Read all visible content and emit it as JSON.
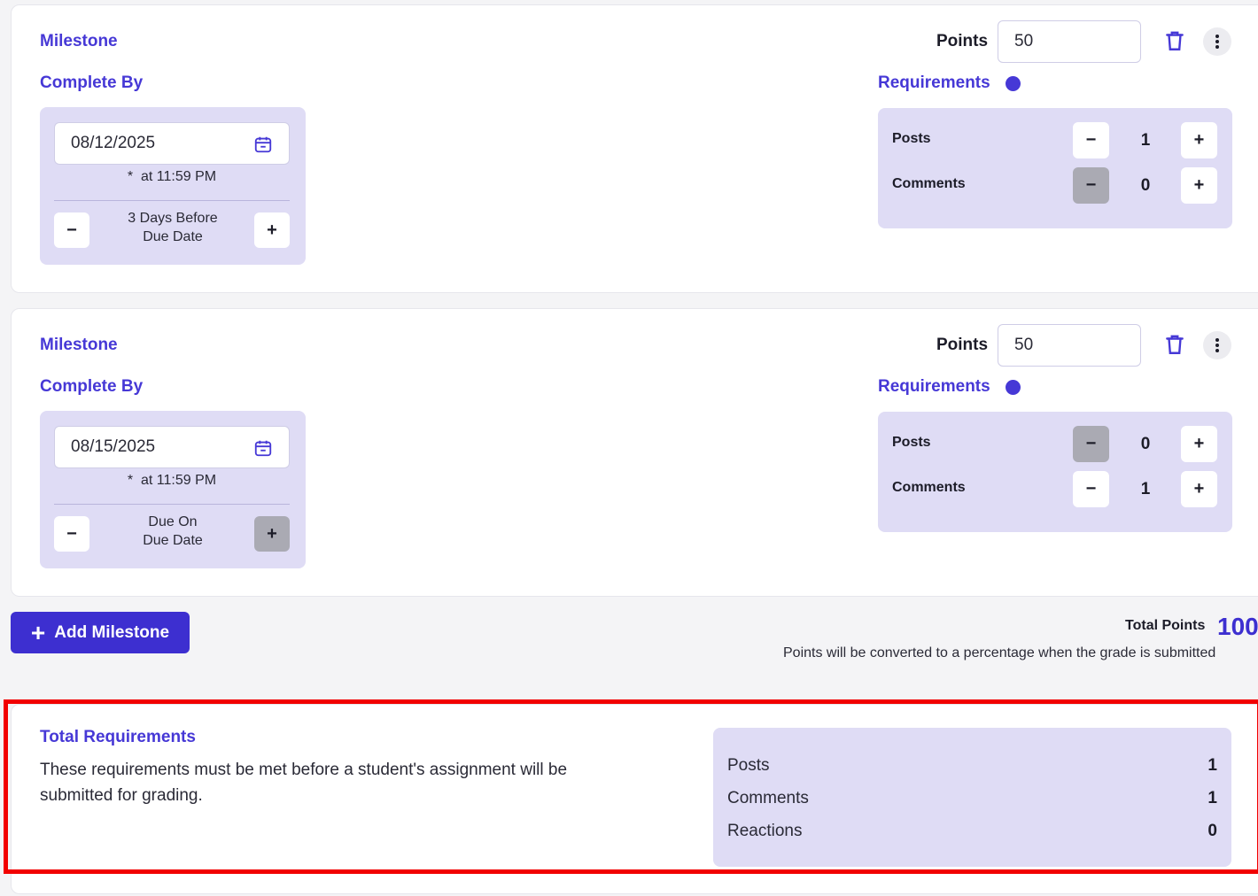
{
  "milestones": [
    {
      "title": "Milestone",
      "complete_by_label": "Complete By",
      "date": "08/12/2025",
      "time": "at 11:59 PM",
      "time_marker": "*",
      "offset_line1": "3 Days Before",
      "offset_line2": "Due Date",
      "offset_plus_enabled": true,
      "points_label": "Points",
      "points_value": "50",
      "requirements_label": "Requirements",
      "requirements": [
        {
          "name": "Posts",
          "value": "1",
          "minus_enabled": true
        },
        {
          "name": "Comments",
          "value": "0",
          "minus_enabled": false
        }
      ]
    },
    {
      "title": "Milestone",
      "complete_by_label": "Complete By",
      "date": "08/15/2025",
      "time": "at 11:59 PM",
      "time_marker": "*",
      "offset_line1": "Due On",
      "offset_line2": "Due Date",
      "offset_plus_enabled": false,
      "points_label": "Points",
      "points_value": "50",
      "requirements_label": "Requirements",
      "requirements": [
        {
          "name": "Posts",
          "value": "0",
          "minus_enabled": false
        },
        {
          "name": "Comments",
          "value": "1",
          "minus_enabled": true
        }
      ]
    }
  ],
  "add_milestone_label": "Add Milestone",
  "total_points": {
    "label": "Total Points",
    "value": "100",
    "note": "Points will be converted to a percentage when the grade is submitted"
  },
  "total_requirements": {
    "title": "Total Requirements",
    "description": "These requirements must be met before a student's assignment will be submitted for grading.",
    "rows": [
      {
        "name": "Posts",
        "value": "1"
      },
      {
        "name": "Comments",
        "value": "1"
      },
      {
        "name": "Reactions",
        "value": "0"
      }
    ]
  },
  "buttons": {
    "minus": "−",
    "plus": "+"
  },
  "colors": {
    "accent": "#4638d6",
    "primary_button": "#3d2fd0",
    "panel": "#dfdcf5",
    "highlight": "#f20000",
    "disabled_step": "#aaaab3"
  }
}
